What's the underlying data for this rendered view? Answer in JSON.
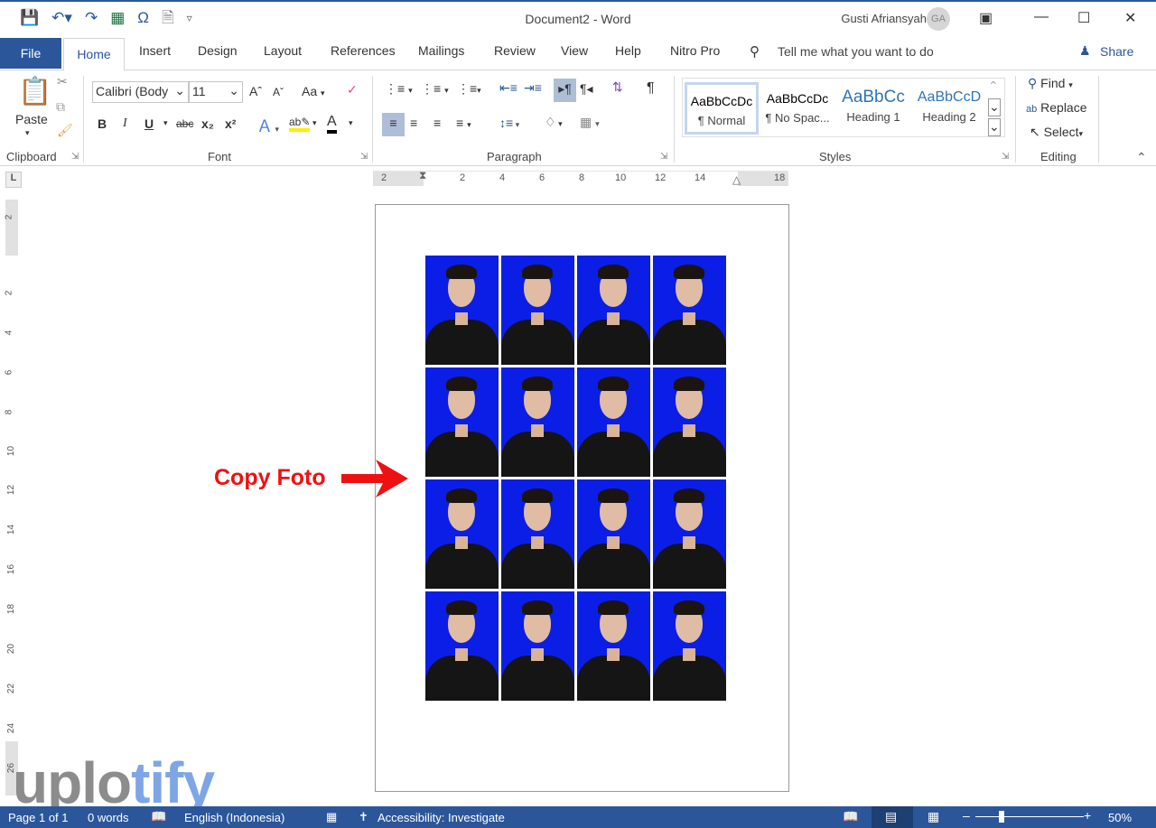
{
  "window": {
    "title": "Document2  -  Word",
    "user": "Gusti Afriansyah",
    "avatar_initials": "GA"
  },
  "qat": {
    "icons": [
      "save-icon",
      "undo-icon",
      "redo-icon",
      "excel-table-icon",
      "omega-symbol-icon",
      "document-icon",
      "customize-icon"
    ]
  },
  "tabs": {
    "file": "File",
    "home": "Home",
    "items": [
      "Insert",
      "Design",
      "Layout",
      "References",
      "Mailings",
      "Review",
      "View",
      "Help",
      "Nitro Pro"
    ],
    "tell_me": "Tell me what you want to do",
    "share": "Share"
  },
  "ribbon": {
    "clipboard": {
      "label": "Clipboard",
      "paste": "Paste"
    },
    "font": {
      "label": "Font",
      "font_name": "Calibri (Body",
      "font_size": "11",
      "change_case": "Aa",
      "bold": "B",
      "italic": "I",
      "underline": "U",
      "strike": "abc",
      "subscript": "x₂",
      "superscript": "x²"
    },
    "paragraph": {
      "label": "Paragraph"
    },
    "styles": {
      "label": "Styles",
      "items": [
        {
          "preview": "AaBbCcDc",
          "name": "¶ Normal"
        },
        {
          "preview": "AaBbCcDc",
          "name": "¶ No Spac..."
        },
        {
          "preview": "AaBbCc",
          "name": "Heading 1"
        },
        {
          "preview": "AaBbCcD",
          "name": "Heading 2"
        }
      ]
    },
    "editing": {
      "label": "Editing",
      "find": "Find",
      "replace": "Replace",
      "select": "Select"
    }
  },
  "ruler": {
    "h_ticks": [
      "2",
      "2",
      "4",
      "6",
      "8",
      "10",
      "12",
      "14",
      "18"
    ],
    "v_ticks": [
      "2",
      "2",
      "4",
      "6",
      "8",
      "10",
      "12",
      "14",
      "16",
      "18",
      "20",
      "22",
      "24",
      "26"
    ]
  },
  "document": {
    "photo_grid": {
      "rows": 4,
      "cols": 4
    },
    "annotation": "Copy Foto"
  },
  "watermark": {
    "part1": "uplo",
    "part2": "tify"
  },
  "status": {
    "page": "Page 1 of 1",
    "words": "0 words",
    "language": "English (Indonesia)",
    "accessibility": "Accessibility: Investigate",
    "zoom": "50%"
  },
  "colors": {
    "accent": "#2b579a",
    "annotation": "#ee1111",
    "photo_bg": "#0b1ee6"
  }
}
